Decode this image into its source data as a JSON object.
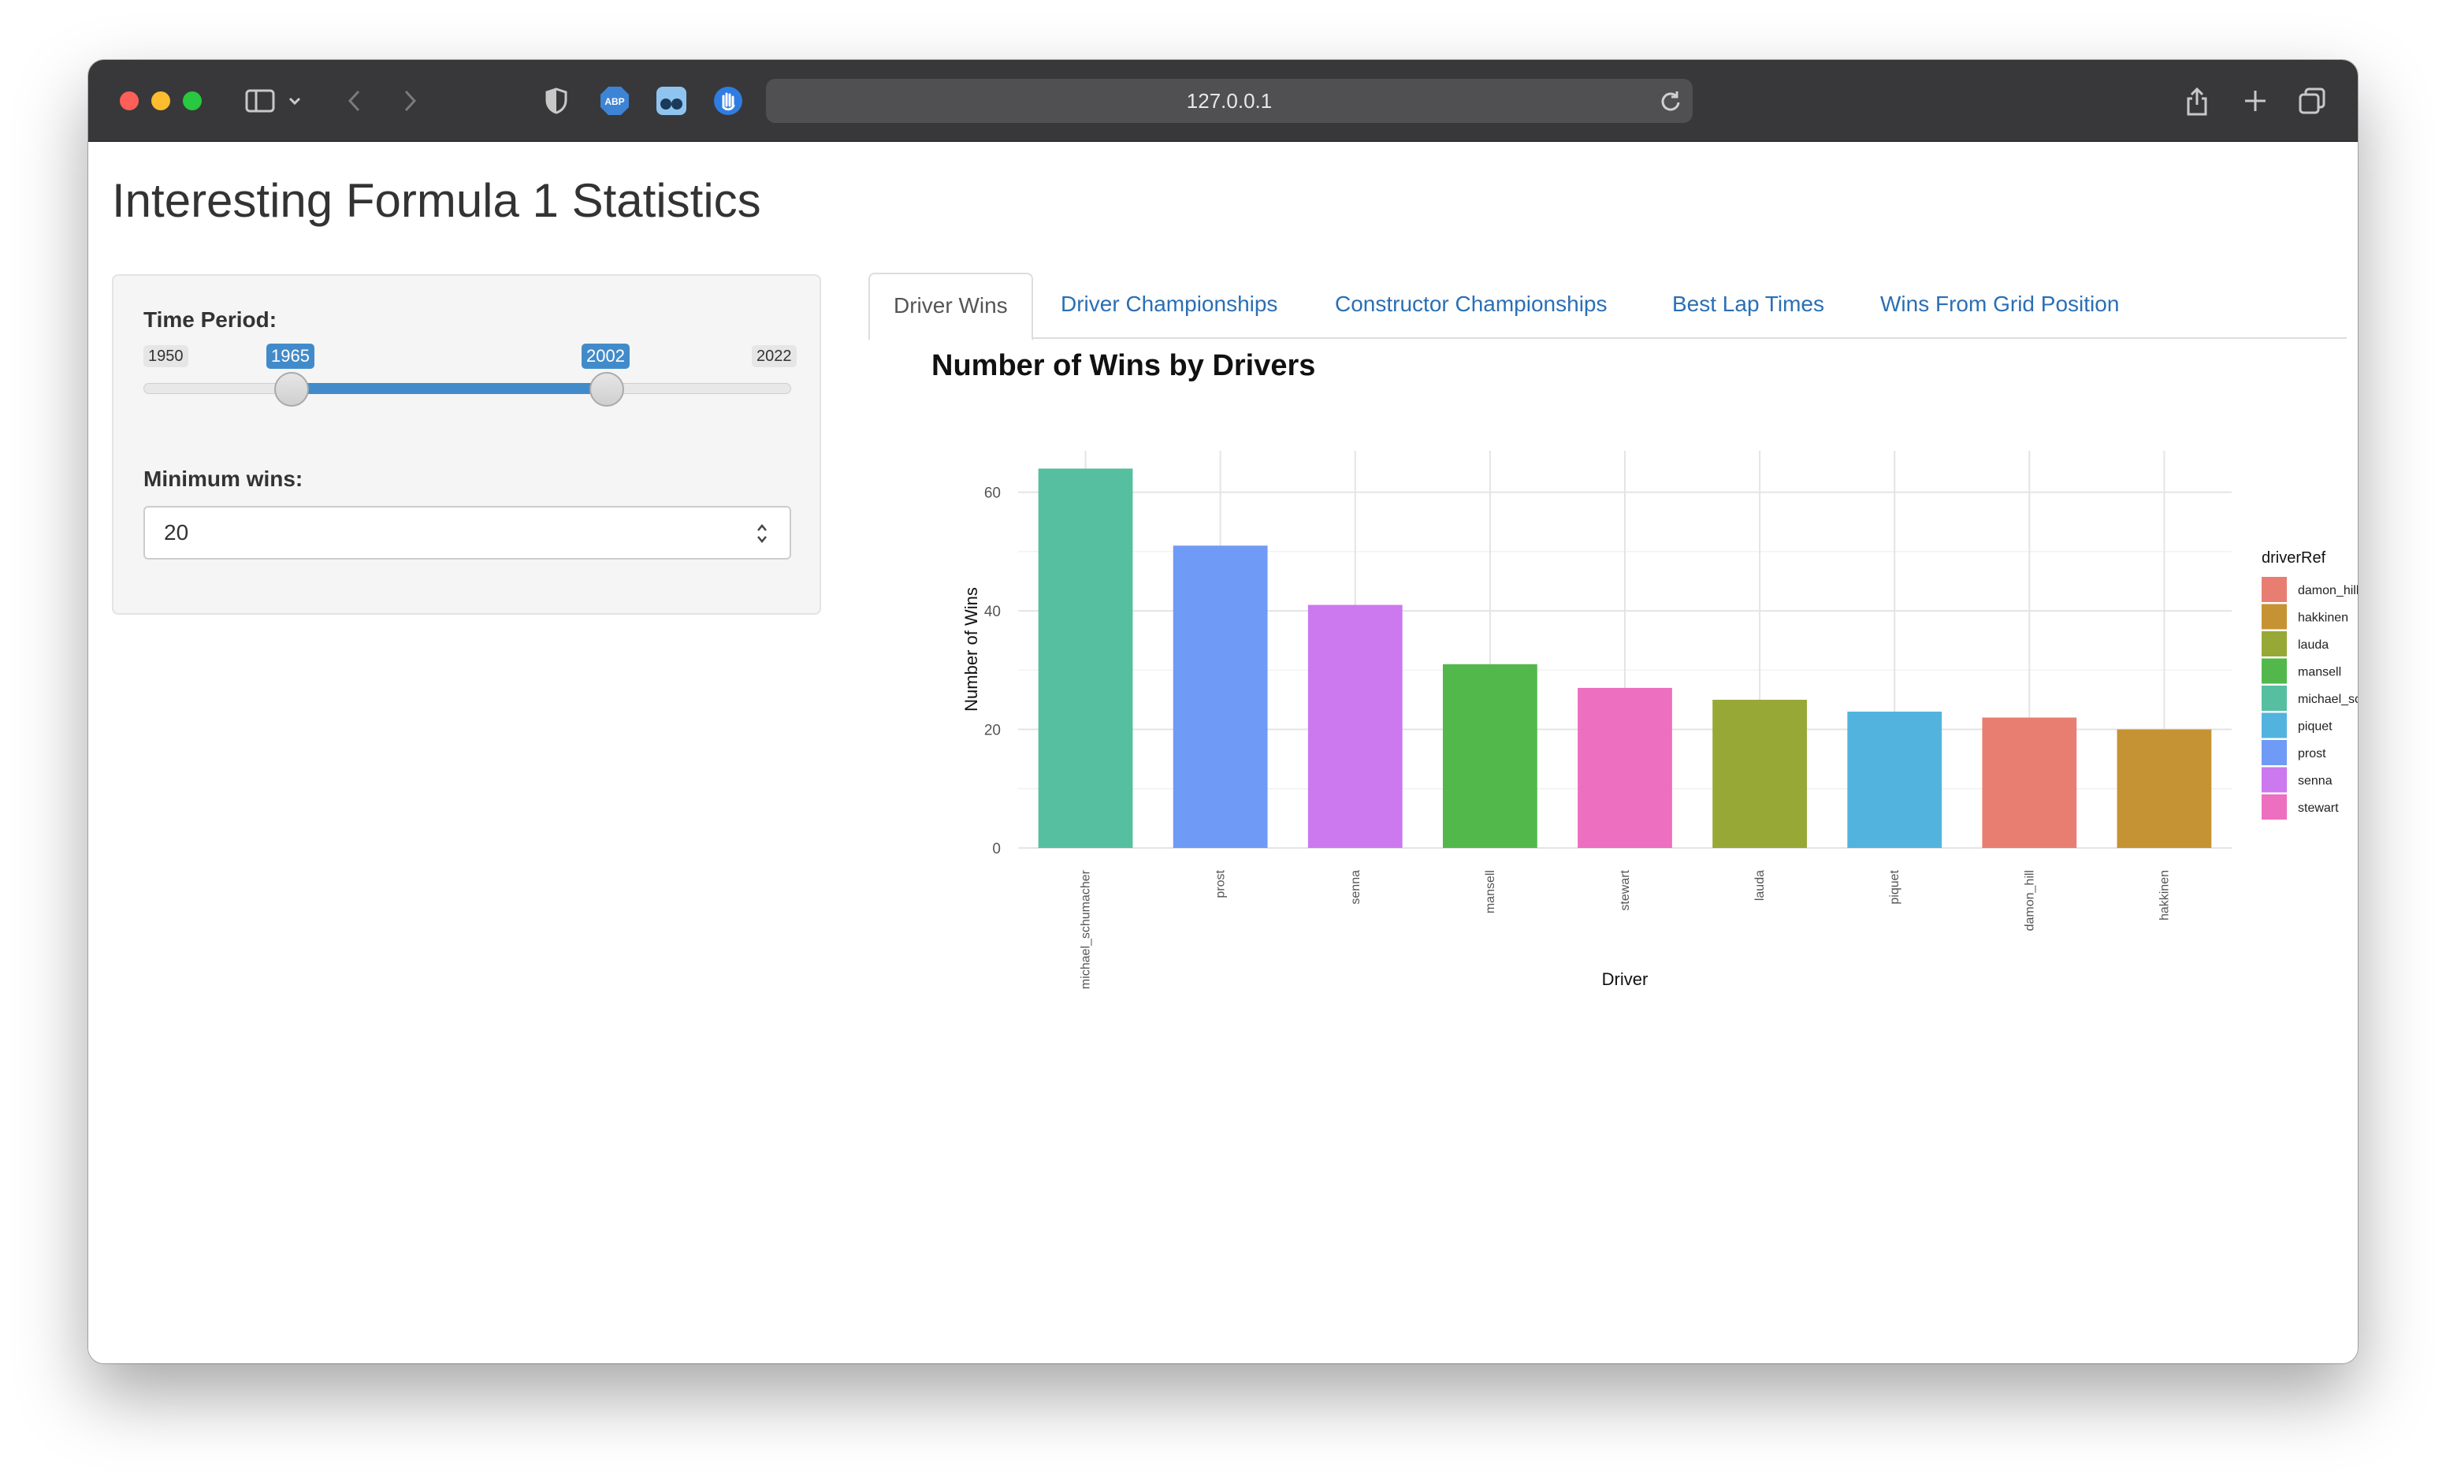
{
  "browser": {
    "url": "127.0.0.1"
  },
  "page": {
    "title": "Interesting Formula 1 Statistics"
  },
  "controls": {
    "time_period": {
      "label": "Time Period:",
      "min": "1950",
      "max": "2022",
      "from": "1965",
      "to": "2002"
    },
    "min_wins": {
      "label": "Minimum wins:",
      "value": "20"
    }
  },
  "tabs": [
    {
      "label": "Driver Wins",
      "active": true
    },
    {
      "label": "Driver Championships",
      "active": false
    },
    {
      "label": "Constructor Championships",
      "active": false
    },
    {
      "label": "Best Lap Times",
      "active": false
    },
    {
      "label": "Wins From Grid Position",
      "active": false
    }
  ],
  "chart_data": {
    "type": "bar",
    "title": "Number of Wins by Drivers",
    "xlabel": "Driver",
    "ylabel": "Number of Wins",
    "ylim": [
      0,
      67
    ],
    "yticks": [
      0,
      20,
      40,
      60
    ],
    "grid": true,
    "legend_title": "driverRef",
    "legend_position": "right",
    "categories": [
      "michael_schumacher",
      "prost",
      "senna",
      "mansell",
      "stewart",
      "lauda",
      "piquet",
      "damon_hill",
      "hakkinen"
    ],
    "values": [
      64,
      51,
      41,
      31,
      27,
      25,
      23,
      22,
      20
    ],
    "colors": {
      "michael_schumacher": "#56bf9f",
      "prost": "#6f9af5",
      "senna": "#cc78ef",
      "mansell": "#52b84c",
      "stewart": "#ec6fc0",
      "lauda": "#98a836",
      "piquet": "#52b4de",
      "damon_hill": "#e87e72",
      "hakkinen": "#c59333"
    },
    "legend": [
      "damon_hill",
      "hakkinen",
      "lauda",
      "mansell",
      "michael_schumacher",
      "piquet",
      "prost",
      "senna",
      "stewart"
    ]
  }
}
